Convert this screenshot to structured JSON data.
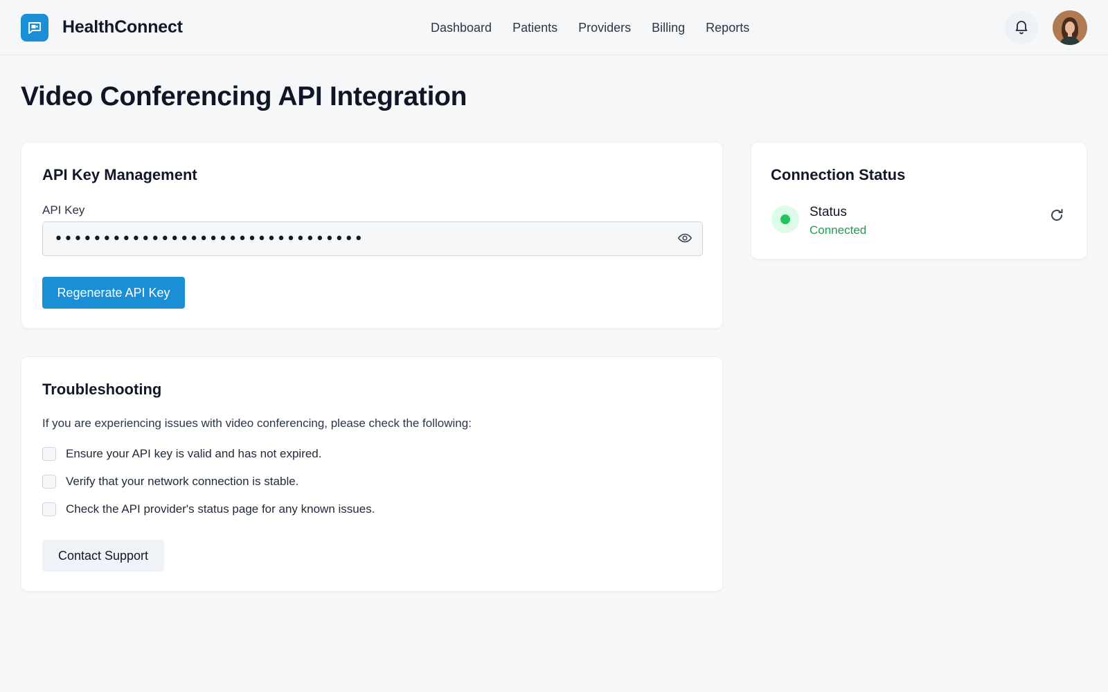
{
  "header": {
    "brand": "HealthConnect",
    "logo_icon": "video-chat-icon",
    "nav": [
      "Dashboard",
      "Patients",
      "Providers",
      "Billing",
      "Reports"
    ],
    "notification_icon": "bell-icon",
    "avatar_icon": "user-avatar"
  },
  "page": {
    "title": "Video Conferencing API Integration"
  },
  "api_card": {
    "title": "API Key Management",
    "field_label": "API Key",
    "api_key_value": "••••••••••••••••••••••••••••••••",
    "toggle_icon": "eye-icon",
    "regenerate_label": "Regenerate API Key"
  },
  "troubleshooting": {
    "title": "Troubleshooting",
    "intro": "If you are experiencing issues with video conferencing, please check the following:",
    "items": [
      "Ensure your API key is valid and has not expired.",
      "Verify that your network connection is stable.",
      "Check the API provider's status page for any known issues."
    ],
    "contact_label": "Contact Support"
  },
  "status_card": {
    "title": "Connection Status",
    "label": "Status",
    "value": "Connected",
    "refresh_icon": "refresh-icon"
  },
  "colors": {
    "primary": "#1b8fd6",
    "success": "#16a34a",
    "background": "#f5f7f9"
  }
}
